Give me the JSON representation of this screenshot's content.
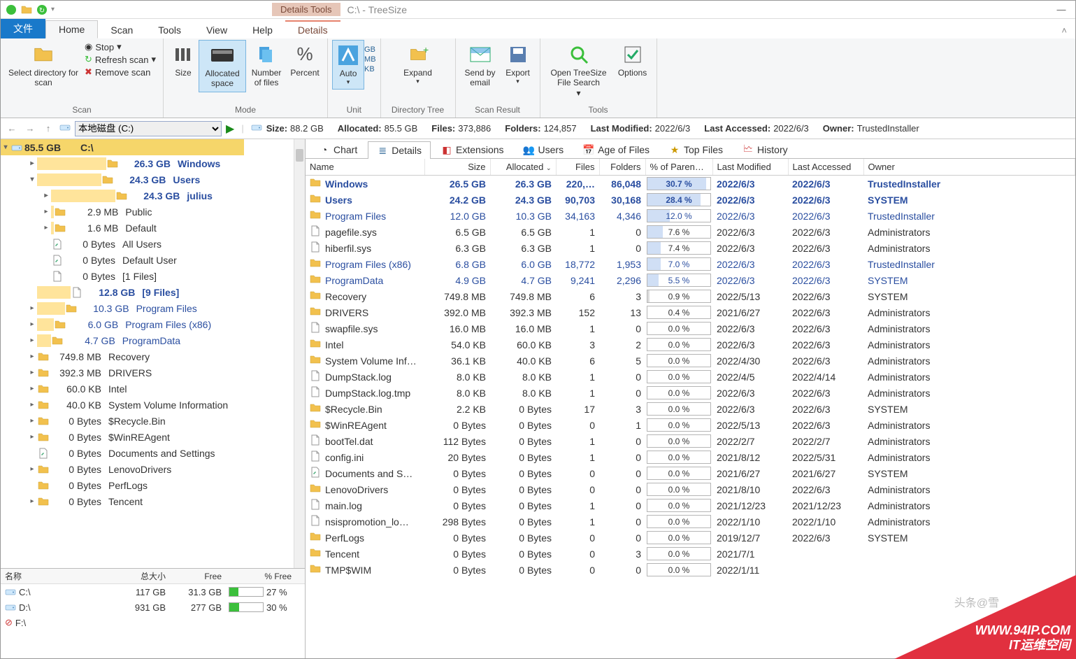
{
  "title": {
    "contextTab": "Details Tools",
    "app": "C:\\ - TreeSize"
  },
  "menu": {
    "file": "文件",
    "home": "Home",
    "scan": "Scan",
    "tools": "Tools",
    "view": "View",
    "help": "Help",
    "details": "Details"
  },
  "ribbon": {
    "scan": {
      "selectDir": "Select directory for scan",
      "stop": "Stop",
      "refresh": "Refresh scan",
      "remove": "Remove scan",
      "group": "Scan"
    },
    "mode": {
      "size": "Size",
      "allocated": "Allocated space",
      "numfiles": "Number of files",
      "percent": "Percent",
      "group": "Mode"
    },
    "unit": {
      "auto": "Auto",
      "gb": "GB",
      "mb": "MB",
      "kb": "KB",
      "group": "Unit"
    },
    "dtree": {
      "expand": "Expand",
      "group": "Directory Tree"
    },
    "result": {
      "send": "Send by email",
      "export": "Export",
      "group": "Scan Result"
    },
    "tools": {
      "openSearch": "Open TreeSize File Search",
      "options": "Options",
      "group": "Tools"
    }
  },
  "nav": {
    "drive": "本地磁盘 (C:)",
    "stats": {
      "sizeK": "Size:",
      "sizeV": "88.2 GB",
      "allocK": "Allocated:",
      "allocV": "85.5 GB",
      "filesK": "Files:",
      "filesV": "373,886",
      "foldersK": "Folders:",
      "foldersV": "124,857",
      "lmK": "Last Modified:",
      "lmV": "2022/6/3",
      "laK": "Last Accessed:",
      "laV": "2022/6/3",
      "ownerK": "Owner:",
      "ownerV": "TrustedInstaller"
    }
  },
  "tree": {
    "root": {
      "size": "85.5 GB",
      "name": "C:\\"
    },
    "items": [
      {
        "d": 1,
        "e": "▸",
        "i": "f",
        "bar": 45,
        "size": "26.3 GB",
        "name": "Windows",
        "cls": "bold"
      },
      {
        "d": 1,
        "e": "▾",
        "i": "f",
        "bar": 42,
        "size": "24.3 GB",
        "name": "Users",
        "cls": "bold"
      },
      {
        "d": 2,
        "e": "▸",
        "i": "f",
        "bar": 42,
        "size": "24.3 GB",
        "name": "julius",
        "cls": "bold"
      },
      {
        "d": 2,
        "e": "▸",
        "i": "f",
        "bar": 2,
        "size": "2.9 MB",
        "name": "Public"
      },
      {
        "d": 2,
        "e": "▸",
        "i": "f",
        "bar": 2,
        "size": "1.6 MB",
        "name": "Default"
      },
      {
        "d": 2,
        "e": "",
        "i": "l",
        "bar": 0,
        "size": "0 Bytes",
        "name": "All Users"
      },
      {
        "d": 2,
        "e": "",
        "i": "l",
        "bar": 0,
        "size": "0 Bytes",
        "name": "Default User"
      },
      {
        "d": 2,
        "e": "",
        "i": "p",
        "bar": 0,
        "size": "0 Bytes",
        "name": "[1 Files]"
      },
      {
        "d": 1,
        "e": "",
        "i": "p",
        "bar": 22,
        "size": "12.8 GB",
        "name": "[9 Files]",
        "cls": "bold boldblack"
      },
      {
        "d": 1,
        "e": "▸",
        "i": "f",
        "bar": 18,
        "size": "10.3 GB",
        "name": "Program Files",
        "cls": "blue"
      },
      {
        "d": 1,
        "e": "▸",
        "i": "f",
        "bar": 11,
        "size": "6.0 GB",
        "name": "Program Files (x86)",
        "cls": "blue"
      },
      {
        "d": 1,
        "e": "▸",
        "i": "f",
        "bar": 9,
        "size": "4.7 GB",
        "name": "ProgramData",
        "cls": "blue"
      },
      {
        "d": 1,
        "e": "▸",
        "i": "f",
        "bar": 0,
        "size": "749.8 MB",
        "name": "Recovery"
      },
      {
        "d": 1,
        "e": "▸",
        "i": "f",
        "bar": 0,
        "size": "392.3 MB",
        "name": "DRIVERS"
      },
      {
        "d": 1,
        "e": "▸",
        "i": "f",
        "bar": 0,
        "size": "60.0 KB",
        "name": "Intel"
      },
      {
        "d": 1,
        "e": "▸",
        "i": "f",
        "bar": 0,
        "size": "40.0 KB",
        "name": "System Volume Information"
      },
      {
        "d": 1,
        "e": "▸",
        "i": "f",
        "bar": 0,
        "size": "0 Bytes",
        "name": "$Recycle.Bin"
      },
      {
        "d": 1,
        "e": "▸",
        "i": "f",
        "bar": 0,
        "size": "0 Bytes",
        "name": "$WinREAgent"
      },
      {
        "d": 1,
        "e": "",
        "i": "l",
        "bar": 0,
        "size": "0 Bytes",
        "name": "Documents and Settings"
      },
      {
        "d": 1,
        "e": "▸",
        "i": "f",
        "bar": 0,
        "size": "0 Bytes",
        "name": "LenovoDrivers"
      },
      {
        "d": 1,
        "e": "",
        "i": "f",
        "bar": 0,
        "size": "0 Bytes",
        "name": "PerfLogs"
      },
      {
        "d": 1,
        "e": "▸",
        "i": "f",
        "bar": 0,
        "size": "0 Bytes",
        "name": "Tencent"
      }
    ]
  },
  "drives": {
    "hdr": {
      "name": "名称",
      "total": "总大小",
      "free": "Free",
      "pct": "% Free"
    },
    "rows": [
      {
        "icon": "d",
        "name": "C:\\",
        "total": "117 GB",
        "free": "31.3 GB",
        "pct": "27 %",
        "pctv": 27
      },
      {
        "icon": "d",
        "name": "D:\\",
        "total": "931 GB",
        "free": "277 GB",
        "pct": "30 %",
        "pctv": 30
      },
      {
        "icon": "x",
        "name": "F:\\",
        "total": "",
        "free": "",
        "pct": "",
        "pctv": 0
      }
    ]
  },
  "tabs": {
    "chart": "Chart",
    "details": "Details",
    "ext": "Extensions",
    "users": "Users",
    "age": "Age of Files",
    "top": "Top Files",
    "history": "History"
  },
  "cols": {
    "name": "Name",
    "size": "Size",
    "alloc": "Allocated",
    "files": "Files",
    "folders": "Folders",
    "pct": "% of Paren…",
    "lm": "Last Modified",
    "la": "Last Accessed",
    "owner": "Owner"
  },
  "rows": [
    {
      "i": "f",
      "name": "Windows",
      "size": "26.5 GB",
      "alloc": "26.3 GB",
      "files": "220,…",
      "folders": "86,048",
      "pct": "30.7 %",
      "pv": 31,
      "lm": "2022/6/3",
      "la": "2022/6/3",
      "owner": "TrustedInstaller",
      "cls": "boldrow",
      "pc": "b"
    },
    {
      "i": "f",
      "name": "Users",
      "size": "24.2 GB",
      "alloc": "24.3 GB",
      "files": "90,703",
      "folders": "30,168",
      "pct": "28.4 %",
      "pv": 28,
      "lm": "2022/6/3",
      "la": "2022/6/3",
      "owner": "SYSTEM",
      "cls": "boldrow",
      "pc": "b"
    },
    {
      "i": "f",
      "name": "Program Files",
      "size": "12.0 GB",
      "alloc": "10.3 GB",
      "files": "34,163",
      "folders": "4,346",
      "pct": "12.0 %",
      "pv": 12,
      "lm": "2022/6/3",
      "la": "2022/6/3",
      "owner": "TrustedInstaller",
      "cls": "bluerow",
      "pc": "b"
    },
    {
      "i": "p",
      "name": "pagefile.sys",
      "size": "6.5 GB",
      "alloc": "6.5 GB",
      "files": "1",
      "folders": "0",
      "pct": "7.6 %",
      "pv": 8,
      "lm": "2022/6/3",
      "la": "2022/6/3",
      "owner": "Administrators",
      "pc": "b"
    },
    {
      "i": "p",
      "name": "hiberfil.sys",
      "size": "6.3 GB",
      "alloc": "6.3 GB",
      "files": "1",
      "folders": "0",
      "pct": "7.4 %",
      "pv": 7,
      "lm": "2022/6/3",
      "la": "2022/6/3",
      "owner": "Administrators",
      "pc": "b"
    },
    {
      "i": "f",
      "name": "Program Files (x86)",
      "size": "6.8 GB",
      "alloc": "6.0 GB",
      "files": "18,772",
      "folders": "1,953",
      "pct": "7.0 %",
      "pv": 7,
      "lm": "2022/6/3",
      "la": "2022/6/3",
      "owner": "TrustedInstaller",
      "cls": "bluerow",
      "pc": "b"
    },
    {
      "i": "f",
      "name": "ProgramData",
      "size": "4.9 GB",
      "alloc": "4.7 GB",
      "files": "9,241",
      "folders": "2,296",
      "pct": "5.5 %",
      "pv": 6,
      "lm": "2022/6/3",
      "la": "2022/6/3",
      "owner": "SYSTEM",
      "cls": "bluerow",
      "pc": "b"
    },
    {
      "i": "f",
      "name": "Recovery",
      "size": "749.8 MB",
      "alloc": "749.8 MB",
      "files": "6",
      "folders": "3",
      "pct": "0.9 %",
      "pv": 1,
      "lm": "2022/5/13",
      "la": "2022/6/3",
      "owner": "SYSTEM",
      "pc": "g"
    },
    {
      "i": "f",
      "name": "DRIVERS",
      "size": "392.0 MB",
      "alloc": "392.3 MB",
      "files": "152",
      "folders": "13",
      "pct": "0.4 %",
      "pv": 0,
      "lm": "2021/6/27",
      "la": "2022/6/3",
      "owner": "Administrators",
      "pc": "g"
    },
    {
      "i": "p",
      "name": "swapfile.sys",
      "size": "16.0 MB",
      "alloc": "16.0 MB",
      "files": "1",
      "folders": "0",
      "pct": "0.0 %",
      "pv": 0,
      "lm": "2022/6/3",
      "la": "2022/6/3",
      "owner": "Administrators",
      "pc": "g"
    },
    {
      "i": "f",
      "name": "Intel",
      "size": "54.0 KB",
      "alloc": "60.0 KB",
      "files": "3",
      "folders": "2",
      "pct": "0.0 %",
      "pv": 0,
      "lm": "2022/6/3",
      "la": "2022/6/3",
      "owner": "Administrators",
      "pc": "g"
    },
    {
      "i": "f",
      "name": "System Volume Inf…",
      "size": "36.1 KB",
      "alloc": "40.0 KB",
      "files": "6",
      "folders": "5",
      "pct": "0.0 %",
      "pv": 0,
      "lm": "2022/4/30",
      "la": "2022/6/3",
      "owner": "Administrators",
      "pc": "g"
    },
    {
      "i": "p",
      "name": "DumpStack.log",
      "size": "8.0 KB",
      "alloc": "8.0 KB",
      "files": "1",
      "folders": "0",
      "pct": "0.0 %",
      "pv": 0,
      "lm": "2022/4/5",
      "la": "2022/4/14",
      "owner": "Administrators",
      "pc": "g"
    },
    {
      "i": "p",
      "name": "DumpStack.log.tmp",
      "size": "8.0 KB",
      "alloc": "8.0 KB",
      "files": "1",
      "folders": "0",
      "pct": "0.0 %",
      "pv": 0,
      "lm": "2022/6/3",
      "la": "2022/6/3",
      "owner": "Administrators",
      "pc": "g"
    },
    {
      "i": "f",
      "name": "$Recycle.Bin",
      "size": "2.2 KB",
      "alloc": "0 Bytes",
      "files": "17",
      "folders": "3",
      "pct": "0.0 %",
      "pv": 0,
      "lm": "2022/6/3",
      "la": "2022/6/3",
      "owner": "SYSTEM",
      "pc": "g"
    },
    {
      "i": "f",
      "name": "$WinREAgent",
      "size": "0 Bytes",
      "alloc": "0 Bytes",
      "files": "0",
      "folders": "1",
      "pct": "0.0 %",
      "pv": 0,
      "lm": "2022/5/13",
      "la": "2022/6/3",
      "owner": "Administrators",
      "pc": "g"
    },
    {
      "i": "p",
      "name": "bootTel.dat",
      "size": "112 Bytes",
      "alloc": "0 Bytes",
      "files": "1",
      "folders": "0",
      "pct": "0.0 %",
      "pv": 0,
      "lm": "2022/2/7",
      "la": "2022/2/7",
      "owner": "Administrators",
      "pc": "g"
    },
    {
      "i": "p",
      "name": "config.ini",
      "size": "20 Bytes",
      "alloc": "0 Bytes",
      "files": "1",
      "folders": "0",
      "pct": "0.0 %",
      "pv": 0,
      "lm": "2021/8/12",
      "la": "2022/5/31",
      "owner": "Administrators",
      "pc": "g"
    },
    {
      "i": "l",
      "name": "Documents and S…",
      "size": "0 Bytes",
      "alloc": "0 Bytes",
      "files": "0",
      "folders": "0",
      "pct": "0.0 %",
      "pv": 0,
      "lm": "2021/6/27",
      "la": "2021/6/27",
      "owner": "SYSTEM",
      "pc": "g"
    },
    {
      "i": "f",
      "name": "LenovoDrivers",
      "size": "0 Bytes",
      "alloc": "0 Bytes",
      "files": "0",
      "folders": "0",
      "pct": "0.0 %",
      "pv": 0,
      "lm": "2021/8/10",
      "la": "2022/6/3",
      "owner": "Administrators",
      "pc": "g"
    },
    {
      "i": "p",
      "name": "main.log",
      "size": "0 Bytes",
      "alloc": "0 Bytes",
      "files": "1",
      "folders": "0",
      "pct": "0.0 %",
      "pv": 0,
      "lm": "2021/12/23",
      "la": "2021/12/23",
      "owner": "Administrators",
      "pc": "g"
    },
    {
      "i": "p",
      "name": "nsispromotion_lo…",
      "size": "298 Bytes",
      "alloc": "0 Bytes",
      "files": "1",
      "folders": "0",
      "pct": "0.0 %",
      "pv": 0,
      "lm": "2022/1/10",
      "la": "2022/1/10",
      "owner": "Administrators",
      "pc": "g"
    },
    {
      "i": "f",
      "name": "PerfLogs",
      "size": "0 Bytes",
      "alloc": "0 Bytes",
      "files": "0",
      "folders": "0",
      "pct": "0.0 %",
      "pv": 0,
      "lm": "2019/12/7",
      "la": "2022/6/3",
      "owner": "SYSTEM",
      "pc": "g"
    },
    {
      "i": "f",
      "name": "Tencent",
      "size": "0 Bytes",
      "alloc": "0 Bytes",
      "files": "0",
      "folders": "3",
      "pct": "0.0 %",
      "pv": 0,
      "lm": "2021/7/1",
      "la": "",
      "owner": "",
      "pc": "g"
    },
    {
      "i": "f",
      "name": "TMP$WIM",
      "size": "0 Bytes",
      "alloc": "0 Bytes",
      "files": "0",
      "folders": "0",
      "pct": "0.0 %",
      "pv": 0,
      "lm": "2022/1/11",
      "la": "",
      "owner": "",
      "pc": "g"
    }
  ],
  "watermark": {
    "line1": "WWW.94IP.COM",
    "line2": "IT运维空间",
    "side": "头条@雪"
  }
}
